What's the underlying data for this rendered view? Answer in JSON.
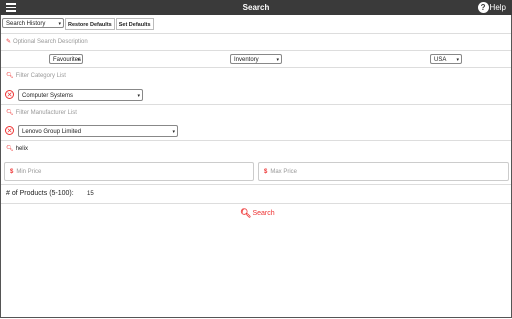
{
  "header": {
    "title": "Search",
    "help_label": "Help",
    "help_glyph": "?"
  },
  "toolbar": {
    "history_select": "Search History",
    "restore_label": "Restore Defaults",
    "set_label": "Set Defaults"
  },
  "description": {
    "placeholder": "Optional Search Description"
  },
  "selects": {
    "favourites": "Favourites",
    "inventory": "Inventory",
    "country": "USA"
  },
  "category": {
    "filter_label": "Filter Category List",
    "selected": "Computer Systems"
  },
  "manufacturer": {
    "filter_label": "Filter Manufacturer List",
    "selected": "Lenovo Group Limited"
  },
  "keyword": {
    "value": "helix"
  },
  "price": {
    "min_placeholder": "Min Price",
    "max_placeholder": "Max Price"
  },
  "products": {
    "label": "# of Products (5-100):",
    "value": "15"
  },
  "search_button": {
    "label": "Search"
  },
  "colors": {
    "accent": "#e33333",
    "topbar": "#3a3a3a"
  }
}
